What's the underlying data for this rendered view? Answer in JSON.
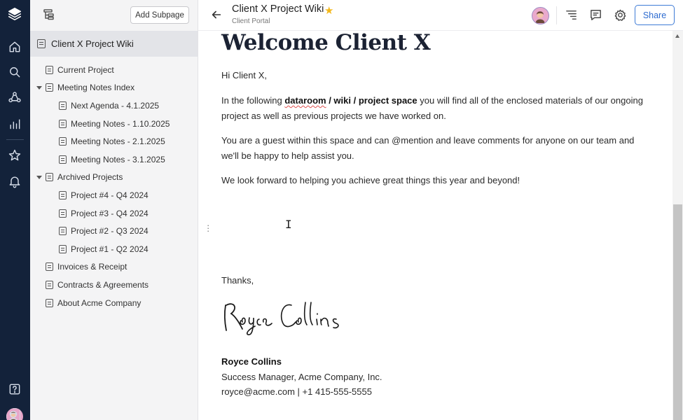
{
  "sidebar": {
    "add_subpage_label": "Add Subpage",
    "root_label": "Client X Project Wiki",
    "items": [
      {
        "label": "Current Project"
      },
      {
        "label": "Meeting Notes Index"
      },
      {
        "label": "Next Agenda - 4.1.2025"
      },
      {
        "label": "Meeting Notes - 1.10.2025"
      },
      {
        "label": "Meeting Notes - 2.1.2025"
      },
      {
        "label": "Meeting Notes - 3.1.2025"
      },
      {
        "label": "Archived Projects"
      },
      {
        "label": "Project #4 - Q4 2024"
      },
      {
        "label": "Project #3 - Q4 2024"
      },
      {
        "label": "Project #2 - Q3 2024"
      },
      {
        "label": "Project #1 - Q2 2024"
      },
      {
        "label": "Invoices & Receipt"
      },
      {
        "label": "Contracts & Agreements"
      },
      {
        "label": "About Acme Company"
      }
    ]
  },
  "header": {
    "title": "Client X Project Wiki",
    "subtitle": "Client Portal",
    "share_label": "Share"
  },
  "content": {
    "heading": "Welcome Client X",
    "greeting": "Hi Client X,",
    "p1_a": "In the following ",
    "p1_b1": "dataroom",
    "p1_b2": " / wiki / project space",
    "p1_c": " you will find all of the enclosed materials of our ongoing project as well as previous projects we have worked on.",
    "p2": "You are a guest within this space and can @mention and leave comments for anyone on our team and we'll be happy to help assist you.",
    "p3": "We look forward to helping you achieve great things this year and beyond!",
    "thanks": "Thanks,",
    "signature_text": "Royce Collins",
    "sign_name": "Royce Collins",
    "sign_title": "Success Manager, Acme Company, Inc.",
    "sign_contact": "royce@acme.com | +1 415-555-5555"
  },
  "colors": {
    "rail": "#13223a",
    "accent": "#2d6bd0",
    "star": "#f3b81b"
  }
}
